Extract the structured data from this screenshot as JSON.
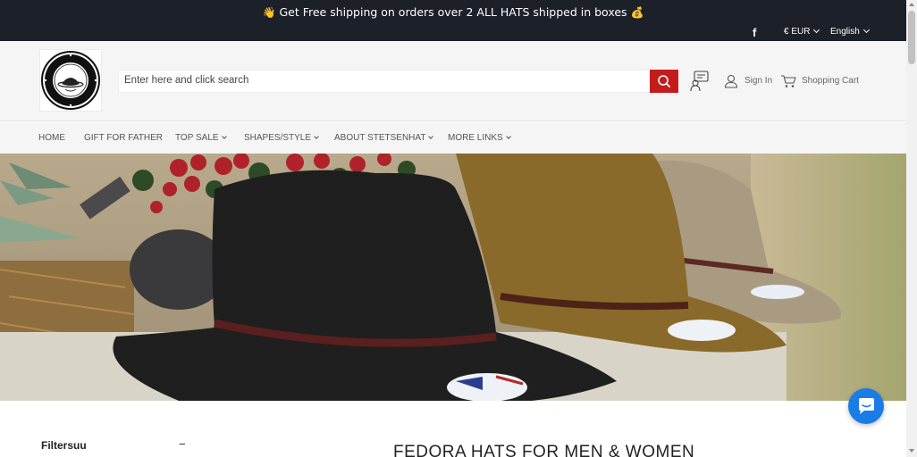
{
  "announcement": {
    "left_emoji": "👋",
    "text": "Get Free shipping on orders over 2 ALL HATS shipped in boxes",
    "right_emoji": "💰"
  },
  "topbar": {
    "facebook_icon": "f",
    "currency": "€ EUR",
    "language": "English"
  },
  "header": {
    "logo_icon": "brand-seal-logo",
    "search_placeholder": "Enter here and click search",
    "search_icon": "search-icon",
    "signin_label": "Sign In",
    "cart_label": "Shopping Cart"
  },
  "nav": {
    "items": [
      {
        "label": "HOME"
      },
      {
        "label": "GIFT FOR FATHER"
      },
      {
        "label": "TOP SALE"
      },
      {
        "label": "SHAPES/STYLE"
      },
      {
        "label": "ABOUT STETSENHAT"
      },
      {
        "label": "MORE LINKS"
      }
    ]
  },
  "hero": {
    "image": "three-fedora-hats-banner"
  },
  "filters": {
    "label": "Filtersuu",
    "toggle": "−"
  },
  "collection": {
    "title": "FEDORA HATS FOR MEN & WOMEN"
  },
  "colors": {
    "topbar_bg": "#1b2029",
    "search_button": "#c41c1c",
    "chat_button": "#1a7ce6",
    "header_bg": "#f5f5f5"
  }
}
